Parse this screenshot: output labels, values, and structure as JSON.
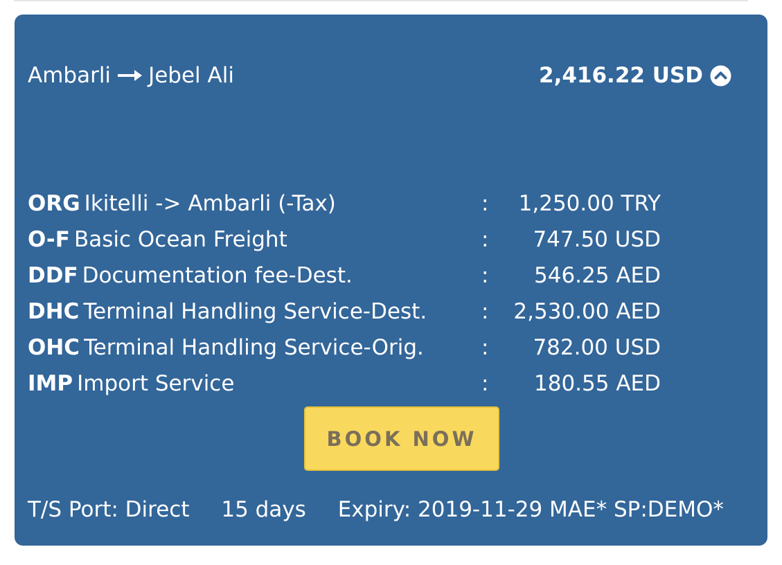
{
  "route": {
    "origin": "Ambarli",
    "destination": "Jebel Ali",
    "arrow_icon": "right-arrow-icon"
  },
  "total": {
    "amount": "2,416.22 USD",
    "toggle_icon": "chevron-up-circle-icon"
  },
  "charges": [
    {
      "code": "ORG",
      "description": "Ikitelli -> Ambarli (-Tax)",
      "separator": ":",
      "amount": "1,250.00 TRY"
    },
    {
      "code": "O-F",
      "description": "Basic Ocean Freight",
      "separator": ":",
      "amount": "747.50 USD"
    },
    {
      "code": "DDF",
      "description": "Documentation fee-Dest.",
      "separator": ":",
      "amount": "546.25 AED"
    },
    {
      "code": "DHC",
      "description": "Terminal Handling Service-Dest.",
      "separator": ":",
      "amount": "2,530.00 AED"
    },
    {
      "code": "OHC",
      "description": "Terminal Handling Service-Orig.",
      "separator": ":",
      "amount": "782.00 USD"
    },
    {
      "code": "IMP",
      "description": "Import Service",
      "separator": ":",
      "amount": "180.55 AED"
    }
  ],
  "book_button": {
    "label": "BOOK NOW"
  },
  "footer": {
    "ts_port": "T/S Port: Direct",
    "transit": "15 days",
    "expiry": "Expiry: 2019-11-29 MAE* SP:DEMO*"
  },
  "colors": {
    "card_background": "#336699",
    "text": "#ffffff",
    "button_background": "#f9d95d",
    "button_text": "#7a6f5a"
  }
}
